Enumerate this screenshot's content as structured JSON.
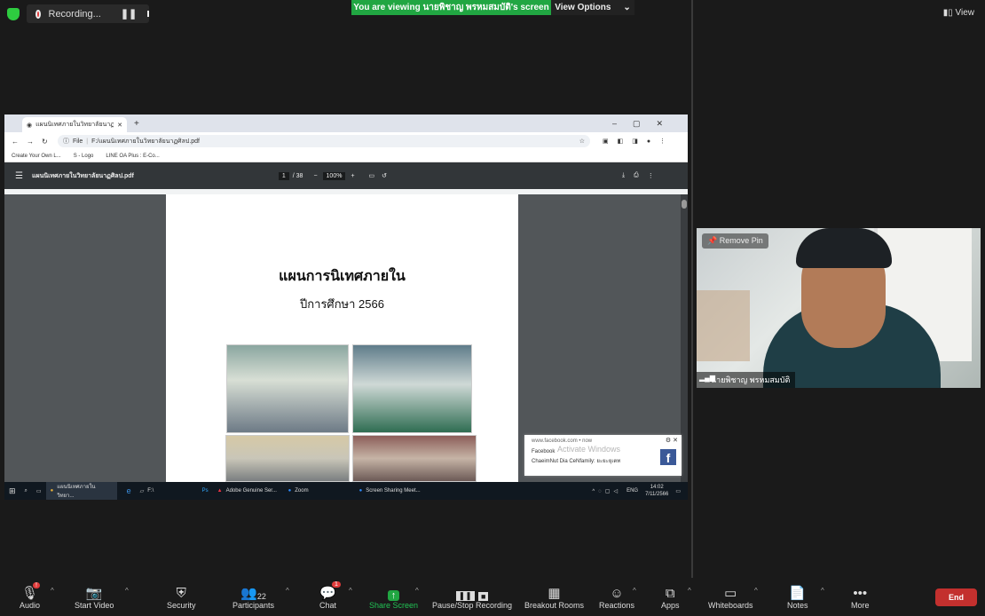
{
  "top": {
    "recording_label": "Recording...",
    "banner": "You are viewing นายพิชาญ พรหมสมบัติ's screen",
    "view_options": "View Options",
    "view_label": "View"
  },
  "browser": {
    "tab_title": "แผนนิเทศภายในวิทยาลัยนาฏศิลป.pdf",
    "url_prefix": "File",
    "url": "F:/แผนนิเทศภายในวิทยาลัยนาฏศิลป.pdf",
    "bookmarks": [
      "Create Your Own L...",
      "S - Logo",
      "LINE OA Plus : E-Co..."
    ]
  },
  "pdf": {
    "filename": "แผนนิเทศภายในวิทยาลัยนาฏศิลป.pdf",
    "page": "1",
    "total_pages": "/ 38",
    "zoom": "100%",
    "title": "แผนการนิเทศภายใน",
    "subtitle": "ปีการศึกษา 2566"
  },
  "notification": {
    "source": "www.facebook.com • now",
    "app": "Facebook",
    "text": "ChaeimNut Dia CeNfamily: ยะยะยุเตท",
    "watermark": "Activate Windows"
  },
  "taskbar": {
    "items": [
      "แผนนิเทศภายในวิทยา...",
      "F:\\",
      "Adobe Genuine Ser...",
      "Zoom",
      "Screen Sharing Meet..."
    ],
    "lang": "ENG",
    "time": "14:02",
    "date": "7/11/2566"
  },
  "video": {
    "remove_pin": "Remove Pin",
    "participant_name": "นายพิชาญ พรหมสมบัติ"
  },
  "toolbar": {
    "audio": "Audio",
    "start_video": "Start Video",
    "security": "Security",
    "participants": "Participants",
    "participants_count": "22",
    "chat": "Chat",
    "chat_badge": "1",
    "audio_badge": "!",
    "share_screen": "Share Screen",
    "pause_recording": "Pause/Stop Recording",
    "breakout": "Breakout Rooms",
    "reactions": "Reactions",
    "apps": "Apps",
    "whiteboards": "Whiteboards",
    "notes": "Notes",
    "more": "More",
    "end": "End"
  },
  "colors": {
    "green": "#21a642",
    "end_red": "#c3302e",
    "background": "#1a1a1a"
  }
}
